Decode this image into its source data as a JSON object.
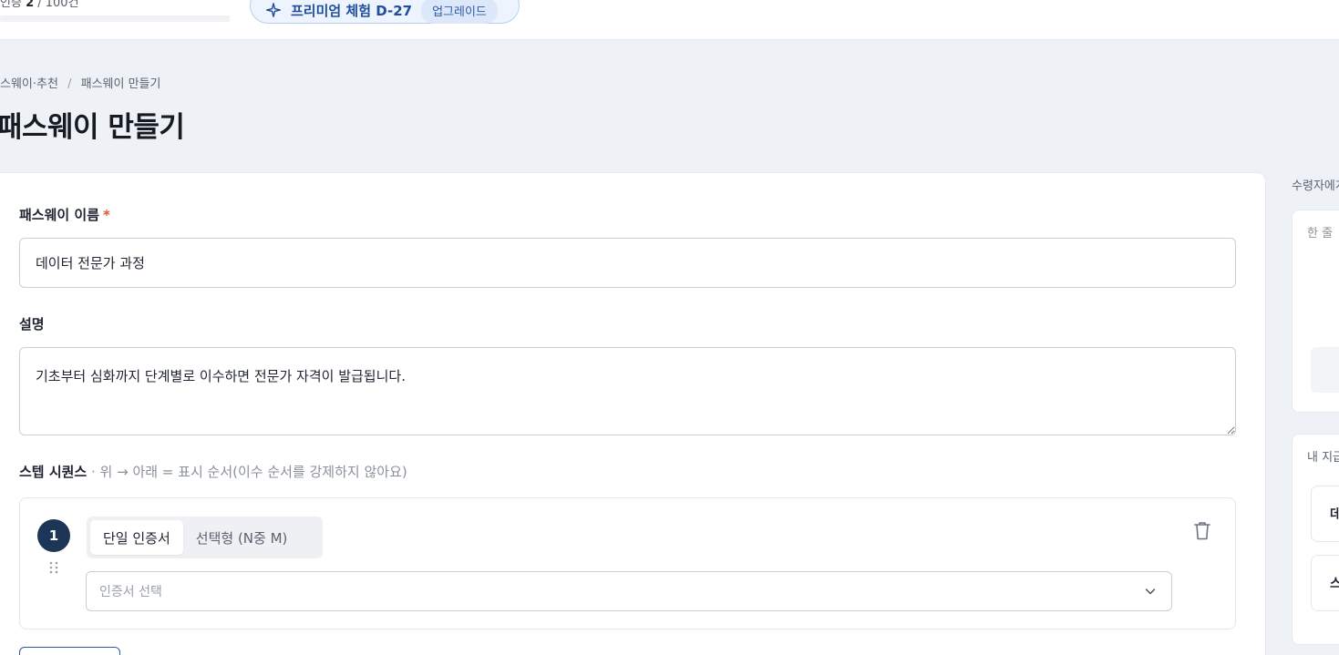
{
  "topbar": {
    "usage_label": "인증",
    "usage_value": "2",
    "usage_total": "/ 100건",
    "premium_text": "프리미엄 체험 D-27",
    "upgrade_label": "업그레이드"
  },
  "breadcrumb": {
    "parent": "스웨이·추천",
    "separator": "/",
    "current": "패스웨이 만들기"
  },
  "page_title": "패스웨이 만들기",
  "form": {
    "name_label": "패스웨이 이름",
    "required_mark": "*",
    "name_value": "데이터 전문가 과정",
    "desc_label": "설명",
    "desc_value": "기초부터 심화까지 단계별로 이수하면 전문가 자격이 발급됩니다.",
    "sequence_title": "스텝 시퀀스",
    "sequence_hint": " · 위 → 아래 = 표시 순서(이수 순서를 강제하지 않아요)"
  },
  "step": {
    "number": "1",
    "tab_single": "단일 인증서",
    "tab_choice": "선택형 (N중 M)",
    "select_placeholder": "인증서 선택"
  },
  "side": {
    "title": "수령자에게",
    "card1_hint": "한 줄",
    "card2_title": "내 지급",
    "item1": "데",
    "item2": "스"
  },
  "colors": {
    "accent": "#1d3557",
    "brand_blue": "#2b5aa8",
    "required": "#e5533b",
    "background": "#eef1f6"
  }
}
